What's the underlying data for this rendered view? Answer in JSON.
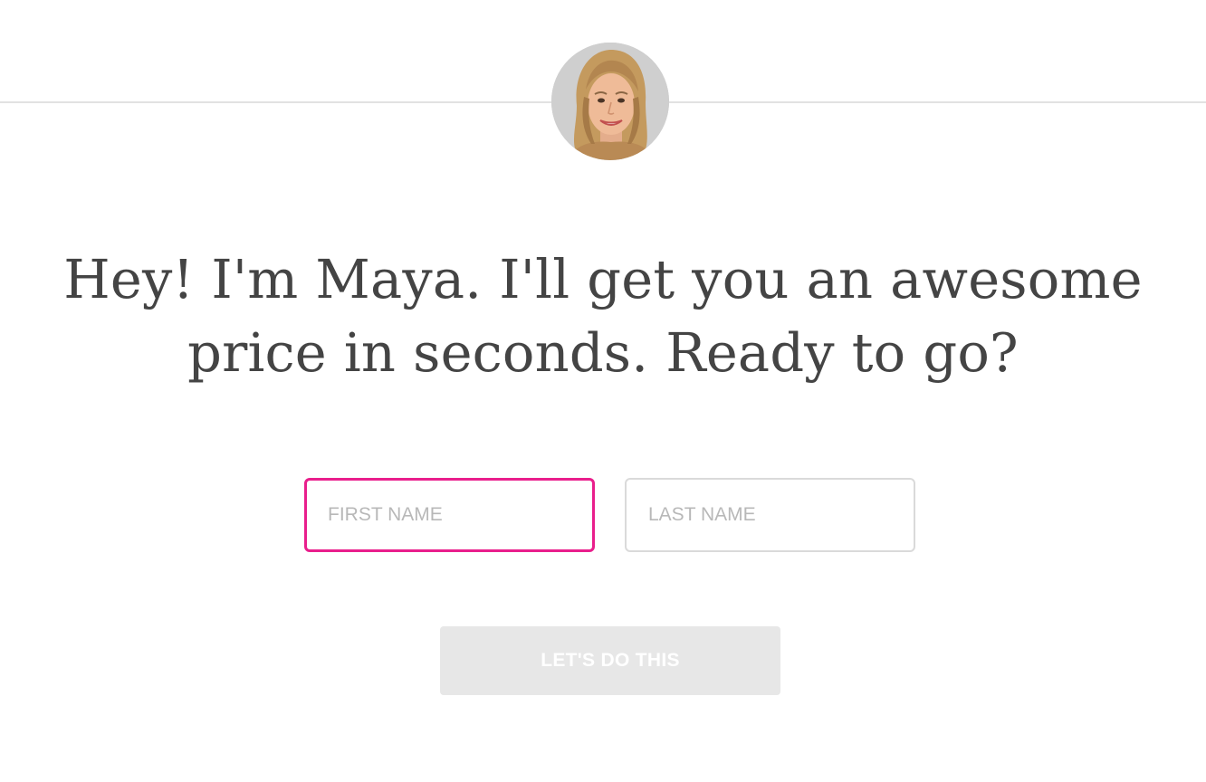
{
  "avatar": {
    "icon": "maya-portrait"
  },
  "headline": {
    "text": "Hey! I'm Maya. I'll get you an awesome price in seconds. Ready to go?"
  },
  "form": {
    "first_name": {
      "placeholder": "FIRST NAME",
      "value": "",
      "state": "focused"
    },
    "last_name": {
      "placeholder": "LAST NAME",
      "value": ""
    },
    "submit_label": "LET'S DO THIS",
    "submit_state": "disabled"
  },
  "colors": {
    "focus_border": "#e91e8c",
    "input_border": "#dadada",
    "headline_text": "#444444",
    "button_bg_disabled": "#e7e7e7",
    "divider": "#e2e2e2"
  }
}
